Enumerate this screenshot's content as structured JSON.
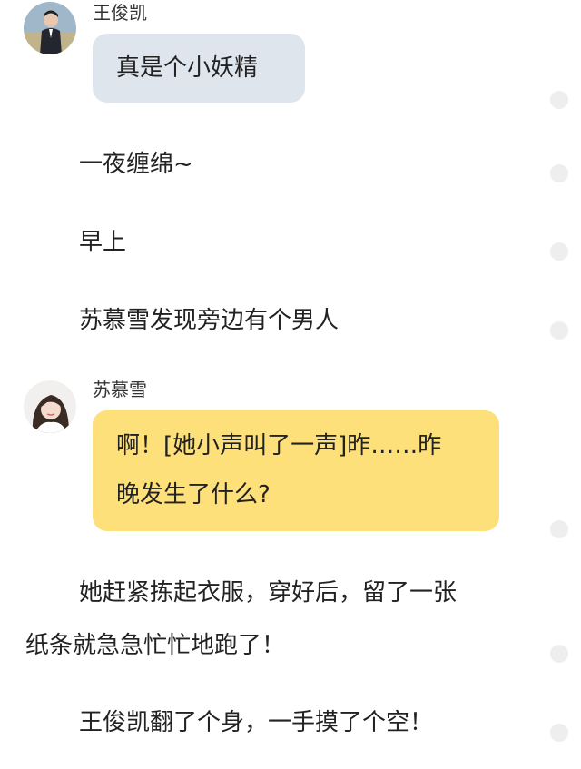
{
  "messages": [
    {
      "type": "chat",
      "speaker": "王俊凯",
      "avatar": "boy-avatar",
      "bubble_color": "#dfe5ec",
      "text": "真是个小妖精"
    },
    {
      "type": "narration",
      "text": "一夜缠绵~"
    },
    {
      "type": "narration",
      "text": "早上"
    },
    {
      "type": "narration",
      "text": "苏慕雪发现旁边有个男人"
    },
    {
      "type": "chat",
      "speaker": "苏慕雪",
      "avatar": "girl-avatar",
      "bubble_color": "#fde07a",
      "text_line1": "啊！[她小声叫了一声]昨……昨",
      "text_line2": "晚发生了什么?"
    },
    {
      "type": "narration",
      "text_line1": "她赶紧拣起衣服，穿好后，留了一张",
      "text_line2": "纸条就急急忙忙地跑了！"
    },
    {
      "type": "narration",
      "text": "王俊凯翻了个身，一手摸了个空！"
    }
  ],
  "colors": {
    "blue_bubble": "#dfe5ec",
    "yellow_bubble": "#fde07a",
    "indicator_dot": "#eeeeee"
  }
}
